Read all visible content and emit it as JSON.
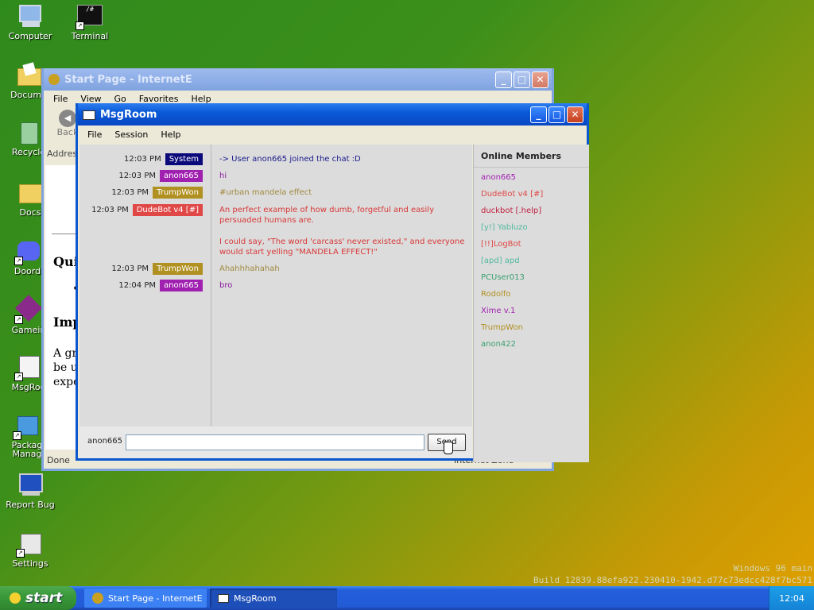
{
  "desktop": {
    "icons": [
      {
        "label": "Computer"
      },
      {
        "label": "Terminal"
      },
      {
        "label": "Docume"
      },
      {
        "label": "Recycle"
      },
      {
        "label": "Docs"
      },
      {
        "label": "Doordi"
      },
      {
        "label": "Gamein"
      },
      {
        "label": "MsgRoo"
      },
      {
        "label": "Packag Manag"
      },
      {
        "label": "Report Bug"
      },
      {
        "label": "Settings"
      }
    ],
    "watermark_line1": "Windows 96 main",
    "watermark_line2": "Build 12839.88efa922.230410-1942.d77c73edcc428f7bc571"
  },
  "browser": {
    "title": "Start Page - InternetE",
    "menu": [
      "File",
      "View",
      "Go",
      "Favorites",
      "Help"
    ],
    "back_label": "Back",
    "address_label": "Address",
    "status_left": "Done",
    "status_right": "Internet Zone",
    "page_heading1": "Qui",
    "page_bullet": "•",
    "page_heading2": "Imp",
    "page_text": [
      "A gr",
      "be us",
      "expe"
    ]
  },
  "chat": {
    "title": "MsgRoom",
    "menu": [
      "File",
      "Session",
      "Help"
    ],
    "messages": [
      {
        "time": "12:03 PM",
        "user": "System",
        "tag_color": "#0a0a7a",
        "text_color": "#1a1a8c",
        "text": "-> User anon665 joined the chat :D"
      },
      {
        "time": "12:03 PM",
        "user": "anon665",
        "tag_color": "#a020b0",
        "text_color": "#8a1aa0",
        "text": "hi"
      },
      {
        "time": "12:03 PM",
        "user": "TrumpWon",
        "tag_color": "#b09020",
        "text_color": "#a08a40",
        "text": "#urban mandela effect"
      },
      {
        "time": "12:03 PM",
        "user": "DudeBot v4 [#]",
        "tag_color": "#e04848",
        "text_color": "#d83838",
        "text": "An perfect example of how dumb, forgetful and easily persuaded humans are.",
        "text2": "I could say, \"The word 'carcass' never existed,\" and everyone would start yelling \"MANDELA EFFECT!\""
      },
      {
        "time": "12:03 PM",
        "user": "TrumpWon",
        "tag_color": "#b09020",
        "text_color": "#a08a40",
        "text": "Ahahhhahahah"
      },
      {
        "time": "12:04 PM",
        "user": "anon665",
        "tag_color": "#a020b0",
        "text_color": "#8a1aa0",
        "text": "bro"
      }
    ],
    "members_title": "Online Members",
    "members": [
      {
        "name": "anon665",
        "color": "#a020b0"
      },
      {
        "name": "DudeBot v4 [#]",
        "color": "#e04848"
      },
      {
        "name": "duckbot [.help]",
        "color": "#c02040"
      },
      {
        "name": "[y!] Yabluzo",
        "color": "#50b8a0"
      },
      {
        "name": "[!!]LogBot",
        "color": "#e04848"
      },
      {
        "name": "[apd] apd",
        "color": "#50b8a0"
      },
      {
        "name": "PCUser013",
        "color": "#3aa070"
      },
      {
        "name": "Rodolfo",
        "color": "#b09020"
      },
      {
        "name": "Xime v.1",
        "color": "#a020b0"
      },
      {
        "name": "TrumpWon",
        "color": "#b09020"
      },
      {
        "name": "anon422",
        "color": "#3aa070"
      }
    ],
    "nick": "anon665",
    "input_value": "",
    "send_label": "Send"
  },
  "taskbar": {
    "start_label": "start",
    "tasks": [
      {
        "label": "Start Page - InternetE"
      },
      {
        "label": "MsgRoom"
      }
    ],
    "clock": "12:04"
  }
}
